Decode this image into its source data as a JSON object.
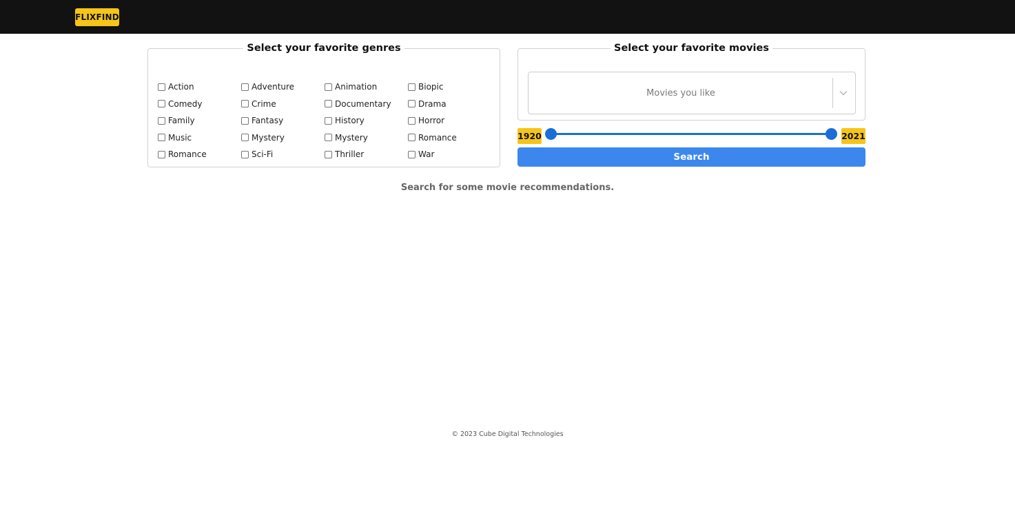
{
  "header": {
    "logo_text": "FLIXFIND"
  },
  "genres_panel": {
    "title": "Select your favorite genres",
    "options": [
      "Action",
      "Adventure",
      "Animation",
      "Biopic",
      "Comedy",
      "Crime",
      "Documentary",
      "Drama",
      "Family",
      "Fantasy",
      "History",
      "Horror",
      "Music",
      "Mystery",
      "Mystery",
      "Romance",
      "Romance",
      "Sci-Fi",
      "Thriller",
      "War"
    ]
  },
  "movies_panel": {
    "title": "Select your favorite movies",
    "placeholder": "Movies you like",
    "dropdown_icon": "chevron-down-icon"
  },
  "year_range": {
    "min_label": "1920",
    "max_label": "2021",
    "min": 1920,
    "max": 2021
  },
  "search_button": {
    "label": "Search"
  },
  "hint": "Search for some movie recommendations.",
  "footer": "© 2023 Cube Digital Technologies",
  "colors": {
    "topbar": "#121212",
    "accent_yellow": "#f5c518",
    "slider_blue": "#1a6fd6",
    "button_blue": "#3b87ee"
  }
}
